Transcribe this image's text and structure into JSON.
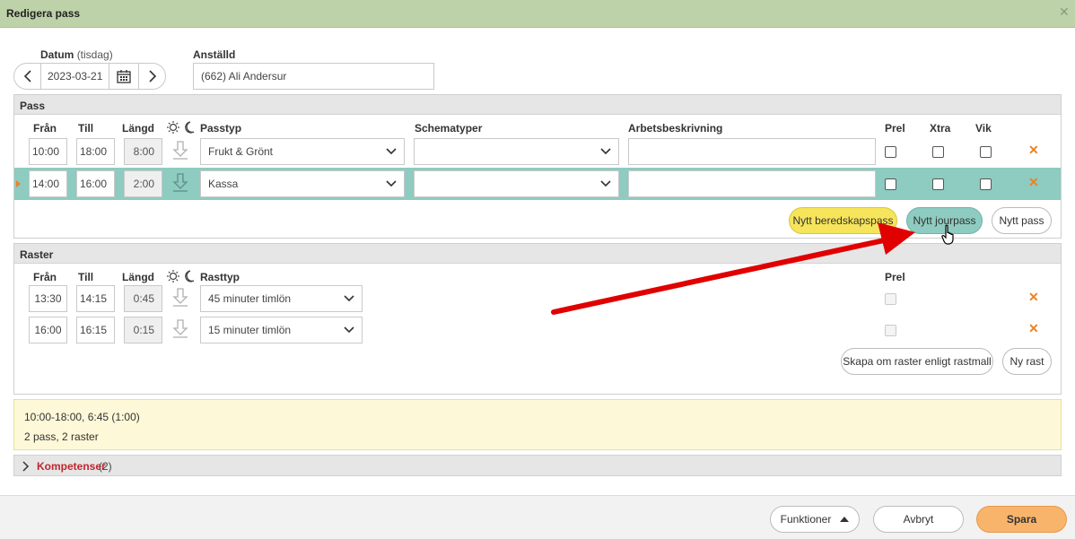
{
  "dialog": {
    "title": "Redigera pass",
    "close_icon": "close-icon"
  },
  "date": {
    "label": "Datum",
    "weekday": "(tisdag)",
    "value": "2023-03-21"
  },
  "employee": {
    "label": "Anställd",
    "value": "(662) Ali Andersur"
  },
  "pass": {
    "section_title": "Pass",
    "headers": {
      "from": "Från",
      "to": "Till",
      "length": "Längd",
      "type": "Passtyp",
      "schema": "Schematyper",
      "desc": "Arbetsbeskrivning",
      "prel": "Prel",
      "xtra": "Xtra",
      "vik": "Vik"
    },
    "rows": [
      {
        "from": "10:00",
        "to": "18:00",
        "length": "8:00",
        "type": "Frukt & Grönt",
        "schema": "",
        "desc": ""
      },
      {
        "from": "14:00",
        "to": "16:00",
        "length": "2:00",
        "type": "Kassa",
        "schema": "",
        "desc": ""
      }
    ],
    "buttons": {
      "beredskap": "Nytt beredskapspass",
      "jour": "Nytt jourpass",
      "new": "Nytt pass"
    }
  },
  "raster": {
    "section_title": "Raster",
    "headers": {
      "from": "Från",
      "to": "Till",
      "length": "Längd",
      "type": "Rasttyp",
      "prel": "Prel"
    },
    "rows": [
      {
        "from": "13:30",
        "to": "14:15",
        "length": "0:45",
        "type": "45 minuter timlön"
      },
      {
        "from": "16:00",
        "to": "16:15",
        "length": "0:15",
        "type": "15 minuter timlön"
      }
    ],
    "buttons": {
      "recreate": "Skapa om raster enligt rastmall",
      "new": "Ny rast"
    }
  },
  "summary": {
    "line1": "10:00-18:00, 6:45 (1:00)",
    "line2": "2 pass, 2 raster"
  },
  "kompetenser": {
    "label": "Kompetenser",
    "count": "(2)"
  },
  "footer": {
    "functions": "Funktioner",
    "cancel": "Avbryt",
    "save": "Spara"
  },
  "colors": {
    "titlebar": "#bdd2a8",
    "highlight_row": "#8ecbc0",
    "accent_orange": "#f9b46c",
    "delete_x": "#e8832a",
    "arrow_red": "#e00000"
  }
}
